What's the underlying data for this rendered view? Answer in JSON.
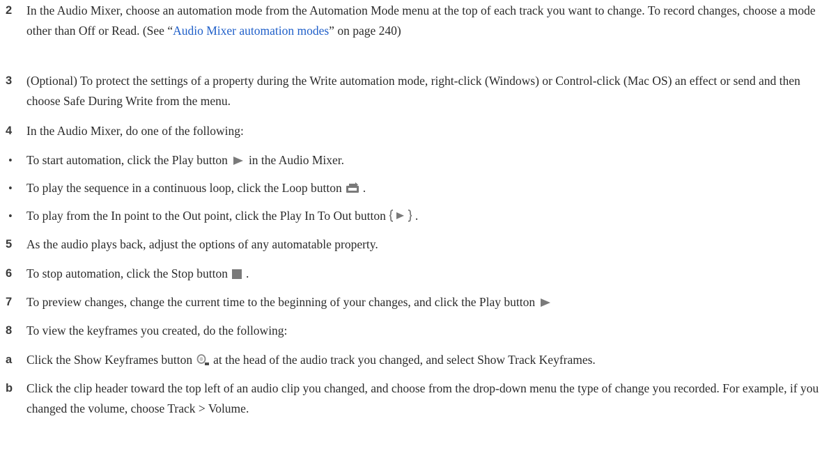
{
  "steps": {
    "s2": {
      "marker": "2",
      "text_a": "In the Audio Mixer, choose an automation mode from the Automation Mode menu at the top of each track you want to change. To record changes, choose a mode other than Off or Read. (See “",
      "link": "Audio Mixer automation modes",
      "text_b": "” on page 240)"
    },
    "s3": {
      "marker": "3",
      "text": "(Optional) To protect the settings of a property during the Write automation mode, right-click (Windows) or Control-click (Mac OS) an effect or send and then choose Safe During Write from the menu."
    },
    "s4": {
      "marker": "4",
      "text": "In the Audio Mixer, do one of the following:"
    },
    "b1": {
      "marker": "•",
      "text_a": "To start automation, click the Play button",
      "text_b": "in the Audio Mixer.",
      "icon": "play-icon"
    },
    "b2": {
      "marker": "•",
      "text_a": "To play the sequence in a continuous loop, click the Loop button",
      "text_b": ".",
      "icon": "loop-icon"
    },
    "b3": {
      "marker": "•",
      "text_a": "To play from the In point to the Out point, click the Play In To Out button",
      "text_b": ".",
      "icon": "play-in-to-out-icon"
    },
    "s5": {
      "marker": "5",
      "text": "As the audio plays back, adjust the options of any automatable property."
    },
    "s6": {
      "marker": "6",
      "text_a": "To stop automation, click the Stop button",
      "text_b": ".",
      "icon": "stop-icon"
    },
    "s7": {
      "marker": "7",
      "text_a": "To preview changes, change the current time to the beginning of your changes, and click the Play button",
      "icon": "play-icon"
    },
    "s8": {
      "marker": "8",
      "text": "To view the keyframes you created, do the following:"
    },
    "sa": {
      "marker": "a",
      "text_a": "Click the Show Keyframes button",
      "text_b": "at the head of the audio track you changed, and select Show Track Keyframes.",
      "icon": "show-keyframes-icon"
    },
    "sb": {
      "marker": "b",
      "text": "Click the clip header toward the top left of an audio clip you changed, and choose from the drop-down menu the type of change you recorded. For example, if you changed the volume, choose Track > Volume."
    }
  },
  "colors": {
    "text": "#2b2b2b",
    "link": "#1f5fc9",
    "icon": "#7a7a7a"
  }
}
